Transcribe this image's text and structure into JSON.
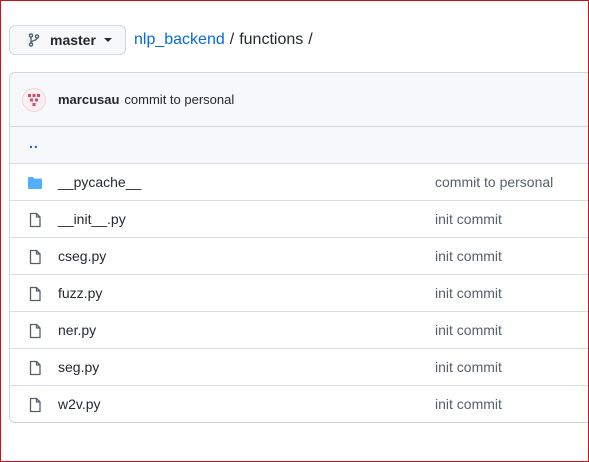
{
  "branch": {
    "label": "master"
  },
  "breadcrumb": {
    "repo": "nlp_backend",
    "separator": "/",
    "current": "functions",
    "trailing": "/"
  },
  "last_commit": {
    "author": "marcusau",
    "message": "commit to personal"
  },
  "parent_dir": {
    "label": ".."
  },
  "files": [
    {
      "icon": "folder-icon",
      "name": "__pycache__",
      "commit": "commit to personal"
    },
    {
      "icon": "file-icon",
      "name": "__init__.py",
      "commit": "init commit"
    },
    {
      "icon": "file-icon",
      "name": "cseg.py",
      "commit": "init commit"
    },
    {
      "icon": "file-icon",
      "name": "fuzz.py",
      "commit": "init commit"
    },
    {
      "icon": "file-icon",
      "name": "ner.py",
      "commit": "init commit"
    },
    {
      "icon": "file-icon",
      "name": "seg.py",
      "commit": "init commit"
    },
    {
      "icon": "file-icon",
      "name": "w2v.py",
      "commit": "init commit"
    }
  ],
  "colors": {
    "link": "#0969da",
    "folder": "#54aeff",
    "text": "#24292f",
    "muted": "#57606a",
    "frame": "#c41818"
  }
}
